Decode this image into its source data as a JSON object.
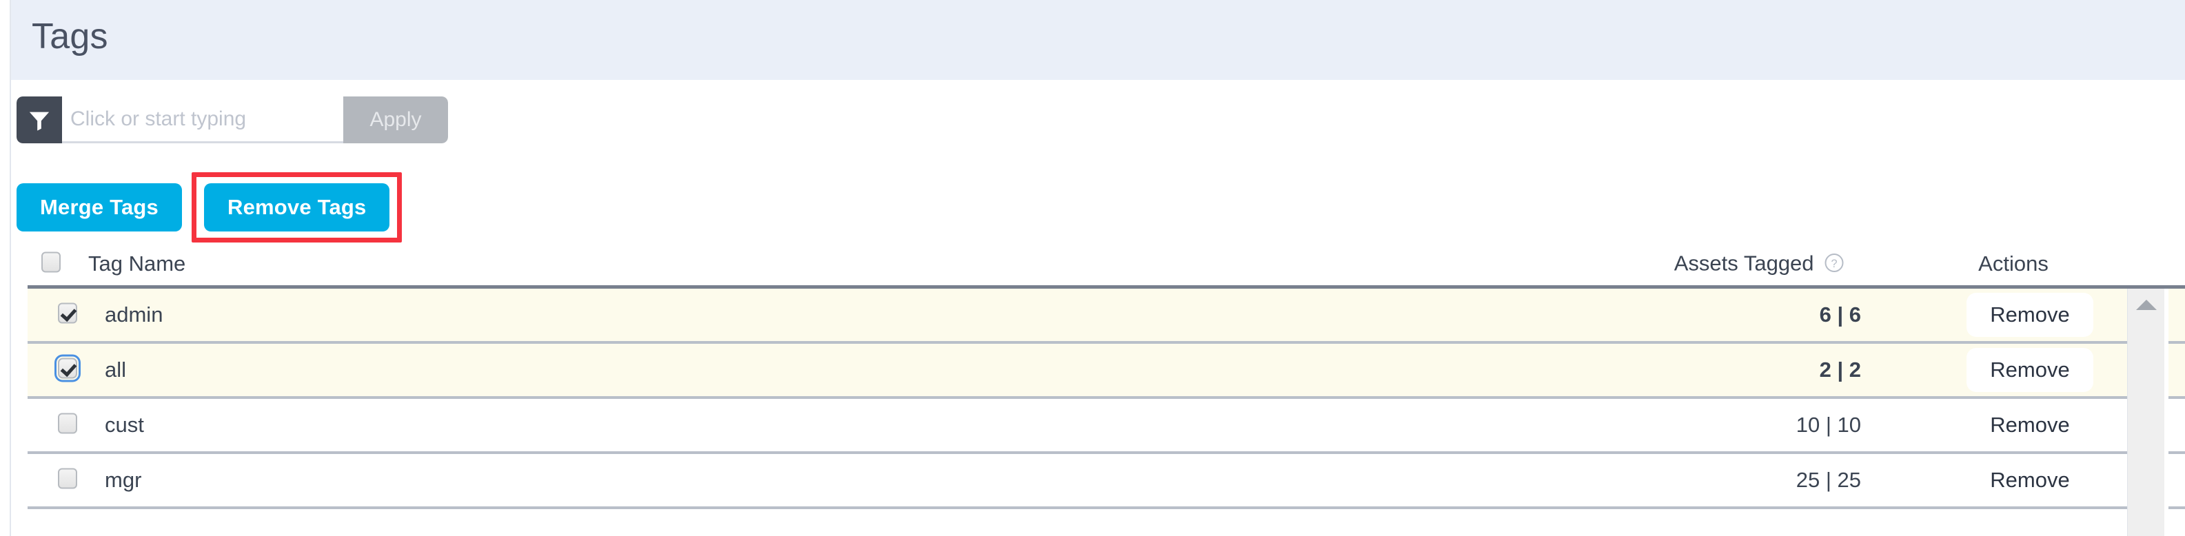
{
  "header": {
    "title": "Tags",
    "band_color": "#eaeff8"
  },
  "filter": {
    "icon": "funnel-icon",
    "placeholder": "Click or start typing",
    "value": "",
    "apply_label": "Apply"
  },
  "actions": {
    "merge_label": "Merge Tags",
    "remove_label": "Remove Tags",
    "primary_color": "#00aee4",
    "highlight_color": "#f5333f"
  },
  "table": {
    "columns": {
      "select_all": "",
      "tag_name": "Tag Name",
      "assets_tagged": "Assets Tagged",
      "assets_tagged_help": "?",
      "actions": "Actions"
    },
    "select_all_checked": false,
    "rows": [
      {
        "checked": true,
        "focused": false,
        "name": "admin",
        "assets_tagged": "6 | 6",
        "action": "Remove"
      },
      {
        "checked": true,
        "focused": true,
        "name": "all",
        "assets_tagged": "2 | 2",
        "action": "Remove"
      },
      {
        "checked": false,
        "focused": false,
        "name": "cust",
        "assets_tagged": "10 | 10",
        "action": "Remove"
      },
      {
        "checked": false,
        "focused": false,
        "name": "mgr",
        "assets_tagged": "25 | 25",
        "action": "Remove"
      }
    ],
    "row_selected_color": "#fdfbec",
    "row_border_color": "#b9bfc9"
  },
  "scrollbar": {
    "up_arrow": "triangle-up-icon"
  }
}
